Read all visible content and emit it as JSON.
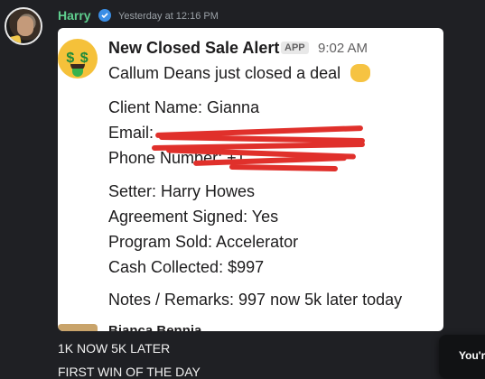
{
  "message": {
    "username": "Harry",
    "timestamp": "Yesterday at 12:16 PM"
  },
  "card": {
    "title": "New Closed Sale Alert",
    "badge": "APP",
    "time": "9:02 AM",
    "headline": "Callum Deans just closed a deal",
    "fields": [
      "Client Name: Gianna",
      "Email:",
      "Phone Number: +1",
      "Setter: Harry Howes",
      "Agreement Signed: Yes",
      "Program Sold: Accelerator",
      "Cash Collected: $997",
      "Notes / Remarks: 997 now 5k later today"
    ],
    "next_preview": "Bianca Bennia"
  },
  "captions": [
    "1K NOW 5K LATER",
    "FIRST WIN OF THE DAY"
  ],
  "tooltip": "You'r",
  "colors": {
    "background": "#1f2024",
    "username": "#5fcf8f",
    "redaction": "#e0302b"
  }
}
